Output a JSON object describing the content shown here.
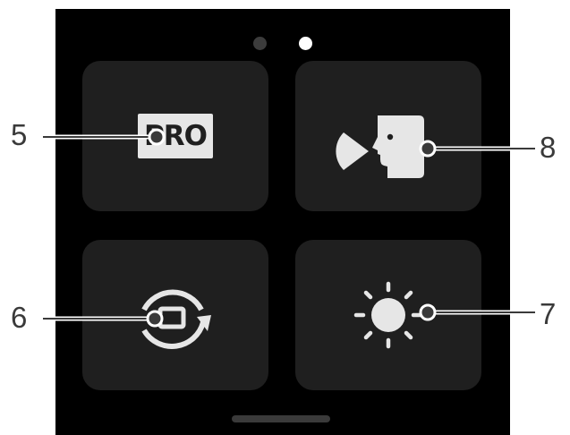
{
  "page_indicator": {
    "total": 2,
    "active_index": 1
  },
  "tiles": {
    "pro": {
      "icon": "pro-mode-icon",
      "badge_text": "PRO"
    },
    "face": {
      "icon": "face-tracking-icon"
    },
    "rotate": {
      "icon": "rotate-screen-icon"
    },
    "brightness": {
      "icon": "brightness-icon"
    }
  },
  "callouts": {
    "pro": "5",
    "rotate": "6",
    "brightness": "7",
    "face": "8"
  },
  "colors": {
    "screen_bg": "#000000",
    "tile_bg": "#1f1f1f",
    "icon": "#e6e6e6",
    "callout": "#3a3a3a"
  }
}
